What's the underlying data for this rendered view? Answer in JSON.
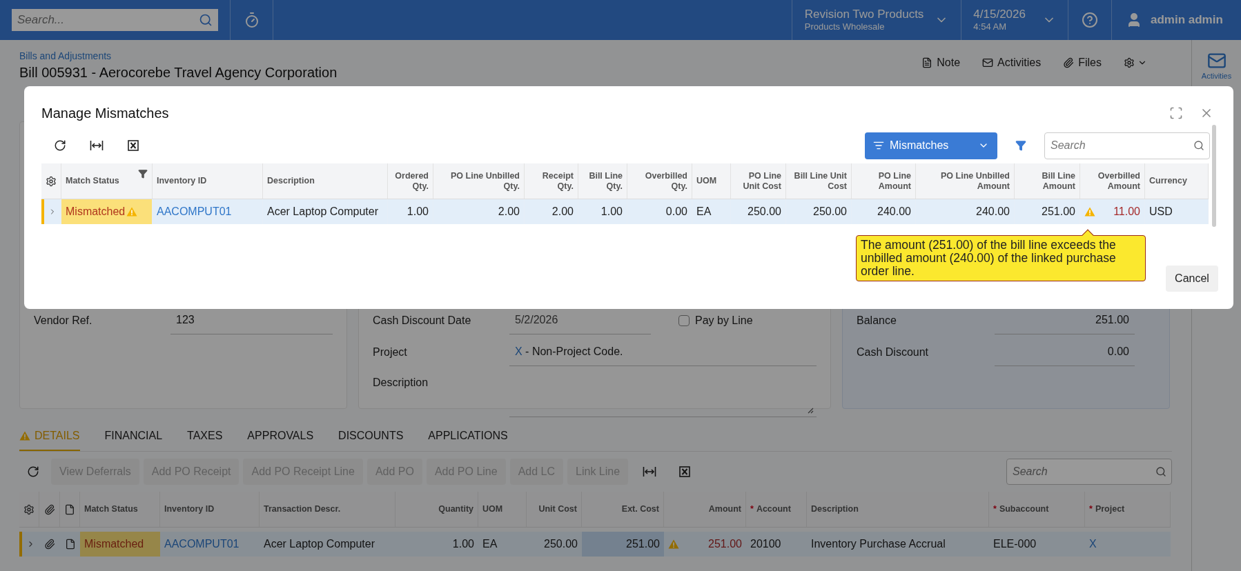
{
  "top_bar": {
    "search": {
      "placeholder": "Search..."
    },
    "company": {
      "name": "Revision Two Products",
      "branch": "Products Wholesale"
    },
    "date": {
      "date": "4/15/2026",
      "time": "4:54 AM"
    },
    "user": {
      "name": "admin admin"
    }
  },
  "page": {
    "breadcrumb": "Bills and Adjustments",
    "title": "Bill 005931 - Aerocorebe Travel Agency Corporation",
    "actions": [
      {
        "kind": "note",
        "label": "Note"
      },
      {
        "kind": "activities",
        "label": "Activities"
      },
      {
        "kind": "files",
        "label": "Files"
      },
      {
        "kind": "settings"
      }
    ]
  },
  "right_panel": {
    "label": "Activities"
  },
  "form": {
    "left": [
      {
        "label": "Vendor Ref.",
        "value": "123"
      }
    ],
    "middle": [
      {
        "kind": "date",
        "label": "Cash Discount Date",
        "value": "5/2/2026",
        "checkbox": {
          "label": "Pay by Line",
          "checked": false
        }
      },
      {
        "kind": "link",
        "label": "Project",
        "link": "X",
        "value": " - Non-Project Code."
      },
      {
        "kind": "textarea",
        "label": "Description"
      }
    ],
    "right": [
      {
        "label": "Balance",
        "value": "251.00"
      },
      {
        "label": "Cash Discount",
        "value": "0.00"
      }
    ]
  },
  "tabs": [
    {
      "label": "DETAILS",
      "selected": true,
      "warning": true
    },
    {
      "label": "FINANCIAL",
      "selected": false,
      "warning": false
    },
    {
      "label": "TAXES",
      "selected": false,
      "warning": false
    },
    {
      "label": "APPROVALS",
      "selected": false,
      "warning": false
    },
    {
      "label": "DISCOUNTS",
      "selected": false,
      "warning": false
    },
    {
      "label": "APPLICATIONS",
      "selected": false,
      "warning": false
    }
  ],
  "details_toolbar": {
    "buttons": [
      {
        "label": "View Deferrals",
        "disabled": true
      },
      {
        "label": "Add PO Receipt",
        "disabled": true
      },
      {
        "label": "Add PO Receipt Line",
        "disabled": true
      },
      {
        "label": "Add PO",
        "disabled": true
      },
      {
        "label": "Add PO Line",
        "disabled": true
      },
      {
        "label": "Add LC",
        "disabled": true
      },
      {
        "label": "Link Line",
        "disabled": true
      }
    ],
    "search": {
      "placeholder": "Search"
    }
  },
  "details_grid": {
    "columns": [
      {
        "kind": "settings"
      },
      {
        "kind": "attach"
      },
      {
        "kind": "note"
      },
      {
        "kind": "status",
        "label": "Match Status"
      },
      {
        "kind": "link",
        "label": "Inventory ID"
      },
      {
        "kind": "text",
        "label": "Transaction Descr."
      },
      {
        "kind": "number",
        "label": "Quantity"
      },
      {
        "kind": "text",
        "label": "UOM"
      },
      {
        "kind": "number",
        "label": "Unit Cost"
      },
      {
        "kind": "number",
        "label": "Ext. Cost"
      },
      {
        "kind": "alert",
        "label": "Amount"
      },
      {
        "kind": "text",
        "label": "Account",
        "mark": "*"
      },
      {
        "kind": "text",
        "label": "Description"
      },
      {
        "kind": "text",
        "label": "Subaccount",
        "mark": "*"
      },
      {
        "kind": "link",
        "label": "Project",
        "mark": "*"
      }
    ],
    "rows": [
      {
        "selected": true,
        "cells": [
          {
            "focused": false
          },
          {
            "focused": false
          },
          {
            "focused": false
          },
          {
            "text": "Mismatched",
            "focused": false
          },
          {
            "text": "AACOMPUT01",
            "focused": false
          },
          {
            "text": "Acer Laptop Computer",
            "focused": false
          },
          {
            "text": "1.00",
            "focused": false
          },
          {
            "text": "EA",
            "focused": false
          },
          {
            "text": "250.00",
            "focused": false
          },
          {
            "text": "251.00",
            "focused": true
          },
          {
            "text": "251.00",
            "focused": false
          },
          {
            "text": "20100",
            "focused": false
          },
          {
            "text": "Inventory Purchase Accrual",
            "focused": false
          },
          {
            "text": "ELE-000",
            "focused": false
          },
          {
            "text": "X",
            "focused": false
          }
        ]
      }
    ]
  },
  "dialog": {
    "title": "Manage Mismatches",
    "toolbar": [
      {
        "kind": "refresh"
      },
      {
        "kind": "fit-columns"
      },
      {
        "kind": "excel"
      }
    ],
    "filter_button": {
      "label": "Mismatches"
    },
    "search": {
      "placeholder": "Search"
    },
    "columns": [
      {
        "kind": "settings"
      },
      {
        "kind": "status",
        "label": "Match Status",
        "filter": true
      },
      {
        "kind": "link",
        "label": "Inventory ID"
      },
      {
        "kind": "text",
        "label": "Description"
      },
      {
        "kind": "number",
        "label": "Ordered Qty."
      },
      {
        "kind": "number",
        "label": "PO Line Unbilled Qty."
      },
      {
        "kind": "number",
        "label": "Receipt Qty."
      },
      {
        "kind": "number",
        "label": "Bill Line Qty."
      },
      {
        "kind": "number",
        "label": "Overbilled Qty."
      },
      {
        "kind": "text",
        "label": "UOM"
      },
      {
        "kind": "number",
        "label": "PO Line Unit Cost"
      },
      {
        "kind": "number",
        "label": "Bill Line Unit Cost"
      },
      {
        "kind": "number",
        "label": "PO Line Amount"
      },
      {
        "kind": "number",
        "label": "PO Line Unbilled Amount"
      },
      {
        "kind": "number",
        "label": "Bill Line Amount"
      },
      {
        "kind": "alert",
        "label": "Overbilled Amount"
      },
      {
        "kind": "text",
        "label": "Currency"
      }
    ],
    "rows": [
      {
        "selected": true,
        "cells": [
          "",
          "Mismatched",
          "AACOMPUT01",
          "Acer Laptop Computer",
          "1.00",
          "2.00",
          "2.00",
          "1.00",
          "0.00",
          "EA",
          "250.00",
          "250.00",
          "240.00",
          "240.00",
          "251.00",
          "11.00",
          "USD"
        ]
      }
    ],
    "tooltip": "The amount (251.00) of the bill line exceeds the unbilled amount (240.00) of the linked purchase order line.",
    "cancel": "Cancel"
  }
}
